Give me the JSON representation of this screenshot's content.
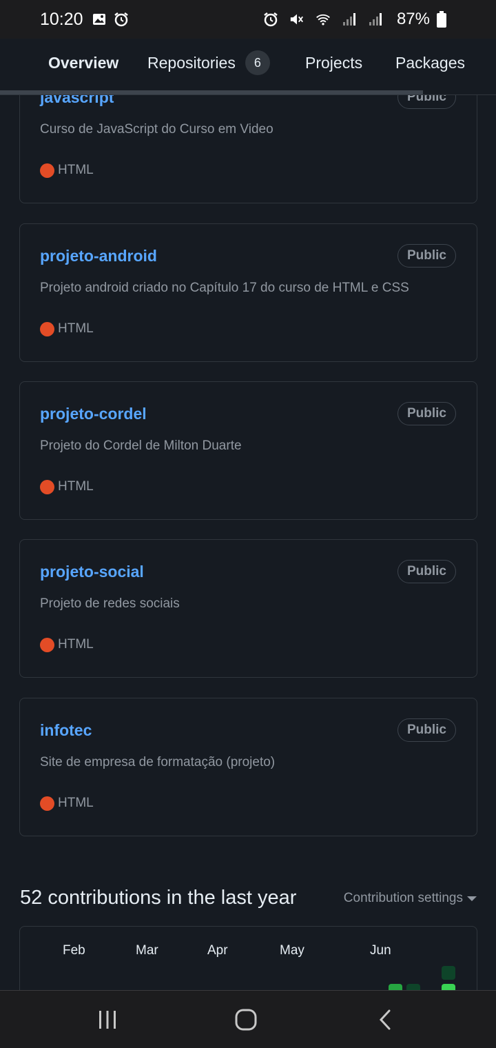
{
  "status_bar": {
    "time": "10:20",
    "battery": "87%"
  },
  "tabs": [
    {
      "label": "Overview",
      "active": true
    },
    {
      "label": "Repositories",
      "count": "6"
    },
    {
      "label": "Projects"
    },
    {
      "label": "Packages"
    }
  ],
  "repos": [
    {
      "name": "javascript",
      "visibility": "Public",
      "description": "Curso de JavaScript do Curso em Video",
      "language": "HTML"
    },
    {
      "name": "projeto-android",
      "visibility": "Public",
      "description": "Projeto android criado no Capítulo 17 do curso de HTML e CSS",
      "language": "HTML"
    },
    {
      "name": "projeto-cordel",
      "visibility": "Public",
      "description": "Projeto do Cordel de Milton Duarte",
      "language": "HTML"
    },
    {
      "name": "projeto-social",
      "visibility": "Public",
      "description": "Projeto de redes sociais",
      "language": "HTML"
    },
    {
      "name": "infotec",
      "visibility": "Public",
      "description": "Site de empresa de formatação (projeto)",
      "language": "HTML"
    }
  ],
  "language_color": "#e34c26",
  "contributions": {
    "title": "52 contributions in the last year",
    "settings_label": "Contribution settings",
    "months": [
      "Feb",
      "Mar",
      "Apr",
      "May",
      "Jun"
    ]
  },
  "colors": {
    "background": "#161b22",
    "link": "#58a6ff",
    "accent_underline": "#f78166"
  }
}
